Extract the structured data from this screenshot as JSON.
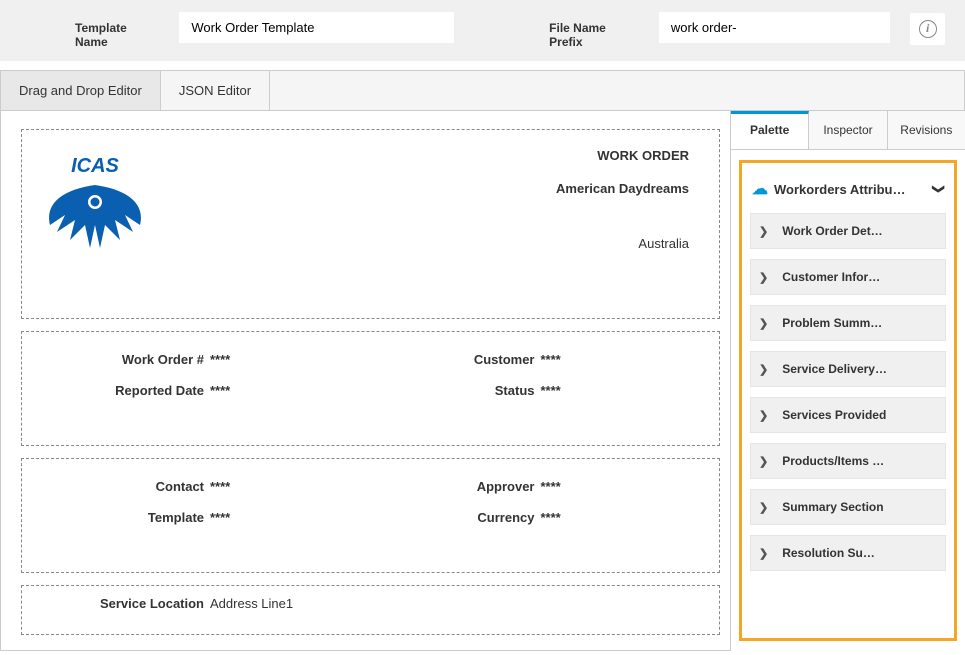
{
  "topbar": {
    "template_label": "Template Name",
    "template_value": "Work Order Template",
    "prefix_label": "File Name Prefix",
    "prefix_value": "work order-"
  },
  "tabs": {
    "drag_drop": "Drag and Drop Editor",
    "json": "JSON Editor"
  },
  "header_box": {
    "logo_text": "ICAS",
    "title": "WORK ORDER",
    "company": "American Daydreams",
    "country": "Australia"
  },
  "fields1": {
    "left": [
      {
        "label": "Work Order #",
        "value": "****"
      },
      {
        "label": "Reported Date",
        "value": "****"
      }
    ],
    "right": [
      {
        "label": "Customer",
        "value": "****"
      },
      {
        "label": "Status",
        "value": "****"
      }
    ]
  },
  "fields2": {
    "left": [
      {
        "label": "Contact",
        "value": "****"
      },
      {
        "label": "Template",
        "value": "****"
      }
    ],
    "right": [
      {
        "label": "Approver",
        "value": "****"
      },
      {
        "label": "Currency",
        "value": "****"
      }
    ]
  },
  "location": {
    "label": "Service Location",
    "value": "Address Line1"
  },
  "side_tabs": {
    "palette": "Palette",
    "inspector": "Inspector",
    "revisions": "Revisions"
  },
  "palette": {
    "group_title": "Workorders Attribu…",
    "items": [
      "Work Order Det…",
      "Customer Infor…",
      "Problem Summ…",
      "Service Delivery…",
      "Services Provided",
      "Products/Items …",
      "Summary Section",
      "Resolution Su…"
    ]
  }
}
